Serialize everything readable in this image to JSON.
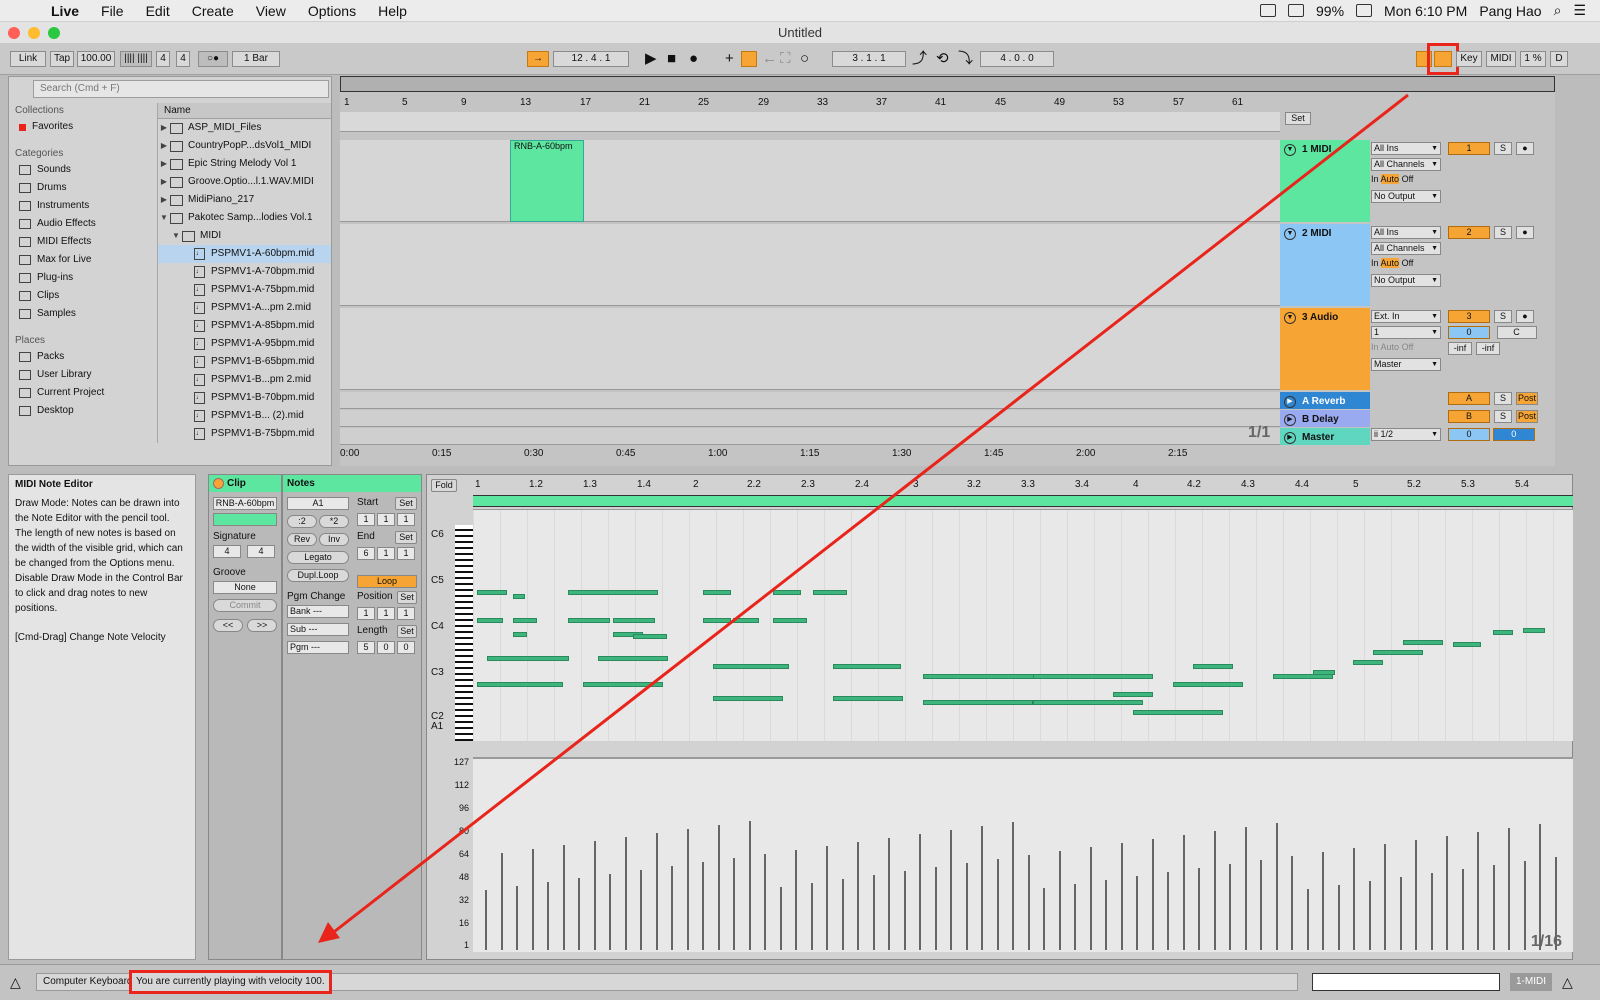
{
  "menubar": {
    "app": "Live",
    "items": [
      "File",
      "Edit",
      "Create",
      "View",
      "Options",
      "Help"
    ],
    "battery": "99%",
    "clock": "Mon 6:10 PM",
    "user": "Pang Hao"
  },
  "window": {
    "title": "Untitled"
  },
  "control": {
    "link": "Link",
    "tap": "Tap",
    "tempo": "100.00",
    "sig_num": "4",
    "sig_den": "4",
    "quant": "1 Bar",
    "position": "12 . 4 . 1",
    "loop_start": "3 . 1 . 1",
    "loop_len": "4 . 0 . 0",
    "key": "Key",
    "midi": "MIDI",
    "cpu": "1 %",
    "d": "D"
  },
  "browser": {
    "search_placeholder": "Search (Cmd + F)",
    "collections_hdr": "Collections",
    "favorites": "Favorites",
    "categories_hdr": "Categories",
    "categories": [
      "Sounds",
      "Drums",
      "Instruments",
      "Audio Effects",
      "MIDI Effects",
      "Max for Live",
      "Plug-ins",
      "Clips",
      "Samples"
    ],
    "places_hdr": "Places",
    "places": [
      "Packs",
      "User Library",
      "Current Project",
      "Desktop"
    ],
    "name_hdr": "Name",
    "folders": [
      "ASP_MIDI_Files",
      "CountryPopP...dsVol1_MIDI",
      "Epic String Melody Vol 1",
      "Groove.Optio...l.1.WAV.MIDI",
      "MidiPiano_217",
      "Pakotec Samp...lodies Vol.1"
    ],
    "subfolder": "MIDI",
    "files": [
      "PSPMV1-A-60bpm.mid",
      "PSPMV1-A-70bpm.mid",
      "PSPMV1-A-75bpm.mid",
      "PSPMV1-A...pm 2.mid",
      "PSPMV1-A-85bpm.mid",
      "PSPMV1-A-95bpm.mid",
      "PSPMV1-B-65bpm.mid",
      "PSPMV1-B...pm 2.mid",
      "PSPMV1-B-70bpm.mid",
      "PSPMV1-B... (2).mid",
      "PSPMV1-B-75bpm.mid"
    ]
  },
  "arrangement": {
    "ruler": [
      "1",
      "5",
      "9",
      "13",
      "17",
      "21",
      "25",
      "29",
      "33",
      "37",
      "41",
      "45",
      "49",
      "53",
      "57",
      "61"
    ],
    "times": [
      "0:00",
      "0:15",
      "0:30",
      "0:45",
      "1:00",
      "1:15",
      "1:30",
      "1:45",
      "2:00",
      "2:15"
    ],
    "set": "Set",
    "page": "1/1",
    "clip_name": "RNB-A-60bpm",
    "tracks": [
      {
        "name": "1 MIDI",
        "color": "#5ce6a0",
        "in": "All Ins",
        "ch": "All Channels",
        "out": "No Output",
        "num": "1"
      },
      {
        "name": "2 MIDI",
        "color": "#8cc6f5",
        "in": "All Ins",
        "ch": "All Channels",
        "out": "No Output",
        "num": "2"
      },
      {
        "name": "3 Audio",
        "color": "#f6a535",
        "in": "Ext. In",
        "ch": "1",
        "out": "Master",
        "num": "3",
        "vol": "0",
        "pan": "C",
        "peak_l": "-inf",
        "peak_r": "-inf"
      }
    ],
    "returns": [
      {
        "name": "A Reverb",
        "num": "A",
        "post": "Post",
        "color": "#2f86d2"
      },
      {
        "name": "B Delay",
        "num": "B",
        "post": "Post",
        "color": "#9aaaf0"
      }
    ],
    "master": {
      "name": "Master",
      "cue": "ii 1/2",
      "vol": "0",
      "pan": "0",
      "color": "#5ed6c0"
    },
    "mon_in": "In",
    "mon_auto": "Auto",
    "mon_off": "Off",
    "solo": "S"
  },
  "info": {
    "title": "MIDI Note Editor",
    "body": "Draw Mode: Notes can be drawn into the Note Editor with the pencil tool. The length of new notes is based on the width of the visible grid, which can be changed from the Options menu. Disable Draw Mode in the Control Bar to click and drag notes to new positions.",
    "hint": "[Cmd-Drag] Change Note Velocity"
  },
  "clip_view": {
    "clip_hdr": "Clip",
    "clip_name": "RNB-A-60bpm",
    "sig_lbl": "Signature",
    "sig_num": "4",
    "sig_den": "4",
    "groove_lbl": "Groove",
    "groove": "None",
    "commit": "Commit",
    "notes_hdr": "Notes",
    "key": "A1",
    "half": ":2",
    "double": "*2",
    "rev": "Rev",
    "inv": "Inv",
    "legato": "Legato",
    "dupl": "Dupl.Loop",
    "pgm_lbl": "Pgm Change",
    "bank": "Bank ---",
    "sub": "Sub ---",
    "pgm": "Pgm ---",
    "start_lbl": "Start",
    "start": [
      "1",
      "1",
      "1"
    ],
    "end_lbl": "End",
    "end": [
      "6",
      "1",
      "1"
    ],
    "loop": "Loop",
    "pos_lbl": "Position",
    "pos": [
      "1",
      "1",
      "1"
    ],
    "len_lbl": "Length",
    "len": [
      "5",
      "0",
      "0"
    ],
    "set": "Set"
  },
  "editor": {
    "fold": "Fold",
    "ruler": [
      "1",
      "1.2",
      "1.3",
      "1.4",
      "2",
      "2.2",
      "2.3",
      "2.4",
      "3",
      "3.2",
      "3.3",
      "3.4",
      "4",
      "4.2",
      "4.3",
      "4.4",
      "5",
      "5.2",
      "5.3",
      "5.4"
    ],
    "keys": [
      "C6",
      "C5",
      "C4",
      "C3",
      "C2",
      "A1"
    ],
    "velocity_labels": [
      "127",
      "112",
      "96",
      "80",
      "64",
      "48",
      "32",
      "16",
      "1"
    ],
    "grid": "1/16"
  },
  "status": {
    "prefix": "Computer Keyboard",
    "message": "You are currently playing with velocity 100.",
    "track": "1-MIDI"
  },
  "colors": {
    "accent": "#f6a535",
    "clip": "#5ce6a0",
    "annot": "#e8241b"
  }
}
